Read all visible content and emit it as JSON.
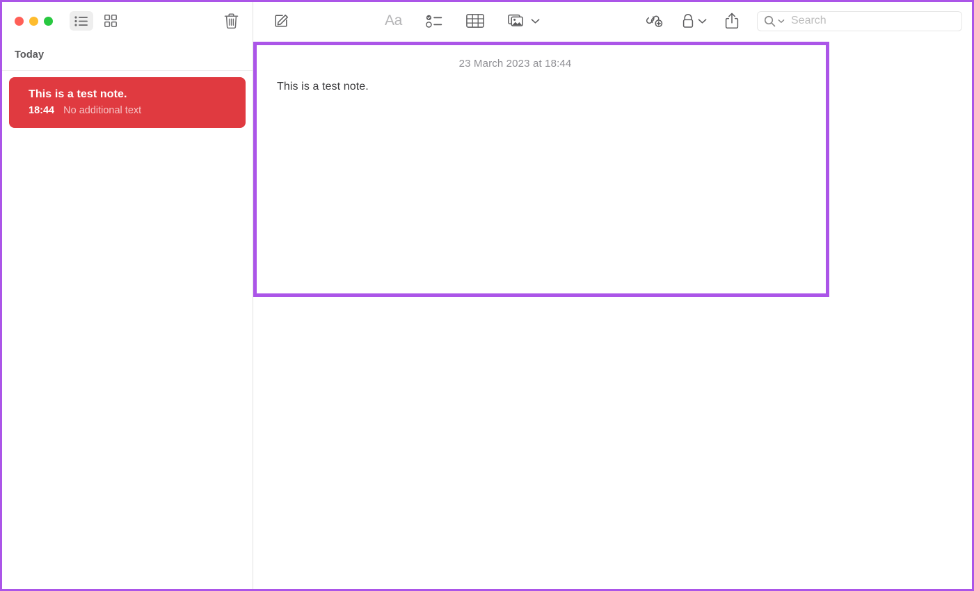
{
  "window": {
    "title": "Notes",
    "annotation_color": "#ab55e8",
    "traffic_lights": [
      {
        "name": "close",
        "color": "#ff5f57"
      },
      {
        "name": "minimize",
        "color": "#febc2e"
      },
      {
        "name": "zoom",
        "color": "#28c840"
      }
    ]
  },
  "sidebar": {
    "view_toggles": [
      {
        "icon": "list-view-icon",
        "label": "List View",
        "selected": true
      },
      {
        "icon": "gallery-view-icon",
        "label": "Gallery View",
        "selected": false
      }
    ],
    "delete_button": {
      "icon": "trash-icon",
      "label": "Delete Note"
    },
    "section_header": "Today",
    "notes": [
      {
        "title": "This is a test note.",
        "time": "18:44",
        "preview": "No additional text",
        "selected": true,
        "selected_color": "#e03a40"
      }
    ]
  },
  "toolbar": {
    "compose": {
      "icon": "compose-icon",
      "label": "New Note"
    },
    "format": {
      "icon": "format-text-icon",
      "label": "Aa"
    },
    "checklist": {
      "icon": "checklist-icon",
      "label": "Checklist"
    },
    "table": {
      "icon": "table-icon",
      "label": "Table"
    },
    "media": {
      "icon": "media-icon",
      "label": "Media",
      "chevron": "chevron-down-icon"
    },
    "collaborate": {
      "icon": "add-collaborator-icon",
      "label": "Add People"
    },
    "lock": {
      "icon": "lock-icon",
      "label": "Lock Note",
      "chevron": "chevron-down-icon"
    },
    "share": {
      "icon": "share-icon",
      "label": "Share"
    },
    "search": {
      "icon": "search-icon",
      "chevron": "chevron-down-icon",
      "placeholder": "Search",
      "value": ""
    }
  },
  "note": {
    "date": "23 March 2023 at 18:44",
    "body": "This is a test note."
  }
}
